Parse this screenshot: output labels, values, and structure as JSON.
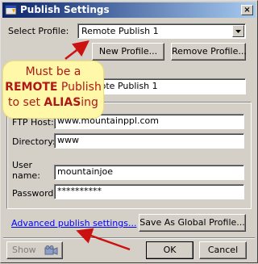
{
  "window": {
    "title": "Publish Settings",
    "close_glyph": "×"
  },
  "profile": {
    "label": "Select Profile:",
    "selected": "Remote Publish 1",
    "new_label": "New Profile...",
    "remove_label": "Remove Profile..."
  },
  "name_field": {
    "value": "Remote Publish 1"
  },
  "callout": {
    "line1": "Must be a",
    "line2_bold": "REMOTE",
    "line2_rest": " Publish",
    "line3_pre": "to set ",
    "line3_bold": "ALIAS",
    "line3_rest": "ing",
    "colors": {
      "background": "#fff8a8",
      "text": "#b01818",
      "arrow": "#cc1111"
    }
  },
  "ftp": {
    "host_label": "FTP Host:",
    "host_value": "www.mountainppl.com",
    "directory_label": "Directory:",
    "directory_value": "www",
    "user_label_1": "User",
    "user_label_2": "name:",
    "user_value": "mountainjoe",
    "password_label": "Password:",
    "password_value": "**********"
  },
  "advanced_link": "Advanced publish settings...",
  "save_global_label": "Save As Global Profile...",
  "footer": {
    "show_label": "Show",
    "show_icon": "camera-icon",
    "ok_label": "OK",
    "cancel_label": "Cancel"
  }
}
